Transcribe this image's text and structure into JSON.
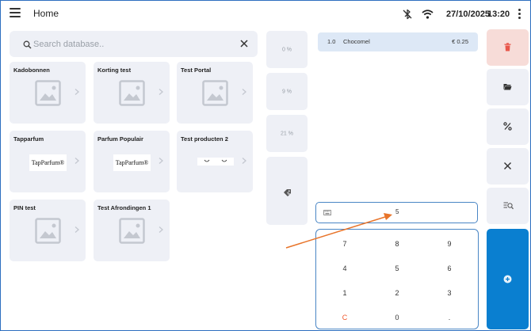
{
  "header": {
    "title": "Home",
    "date": "27/10/2025",
    "time": "13:20",
    "icons": [
      "menu-icon",
      "bluetooth-off-icon",
      "wifi-icon",
      "more-vertical-icon"
    ]
  },
  "search": {
    "placeholder": "Search database..",
    "value": ""
  },
  "tiles": [
    {
      "label": "Kadobonnen",
      "image": "image-placeholder-icon"
    },
    {
      "label": "Korting test",
      "image": "image-placeholder-icon"
    },
    {
      "label": "Test Portal",
      "image": "image-placeholder-icon"
    },
    {
      "label": "Tapparfum",
      "image": "brand-logo",
      "logo_text": "TapParfum®"
    },
    {
      "label": "Parfum Populair",
      "image": "brand-logo",
      "logo_text": "TapParfum®"
    },
    {
      "label": "Test producten 2",
      "image": "strip-image"
    },
    {
      "label": "PIN test",
      "image": "image-placeholder-icon"
    },
    {
      "label": "Test Afrondingen 1",
      "image": "image-placeholder-icon"
    }
  ],
  "discounts": [
    {
      "label": "0 %"
    },
    {
      "label": "9 %"
    },
    {
      "label": "21 %"
    },
    {
      "label": "",
      "icon": "price-tag-icon"
    }
  ],
  "order": {
    "lines": [
      {
        "qty": "1.0",
        "name": "Chocomel",
        "price": "€ 0.25"
      }
    ]
  },
  "entry": {
    "value": "5"
  },
  "numpad": {
    "keys": [
      "7",
      "8",
      "9",
      "4",
      "5",
      "6",
      "1",
      "2",
      "3",
      "C",
      "0",
      "."
    ]
  },
  "actions": [
    {
      "name": "delete",
      "icon": "trash-icon"
    },
    {
      "name": "open",
      "icon": "folder-open-icon"
    },
    {
      "name": "discount",
      "icon": "percent-icon"
    },
    {
      "name": "cancel",
      "icon": "close-icon"
    },
    {
      "name": "lookup",
      "icon": "search-list-icon"
    },
    {
      "name": "confirm",
      "icon": "add-circle-icon"
    }
  ],
  "colors": {
    "accent": "#0a7fd0",
    "border_focus": "#4a86c5",
    "tile_bg": "#eef0f6",
    "order_line_bg": "#dde8f6",
    "delete_bg": "#f7dcd8",
    "delete_icon": "#e8564a",
    "clear_key": "#f0572b",
    "arrow": "#e8742a"
  }
}
